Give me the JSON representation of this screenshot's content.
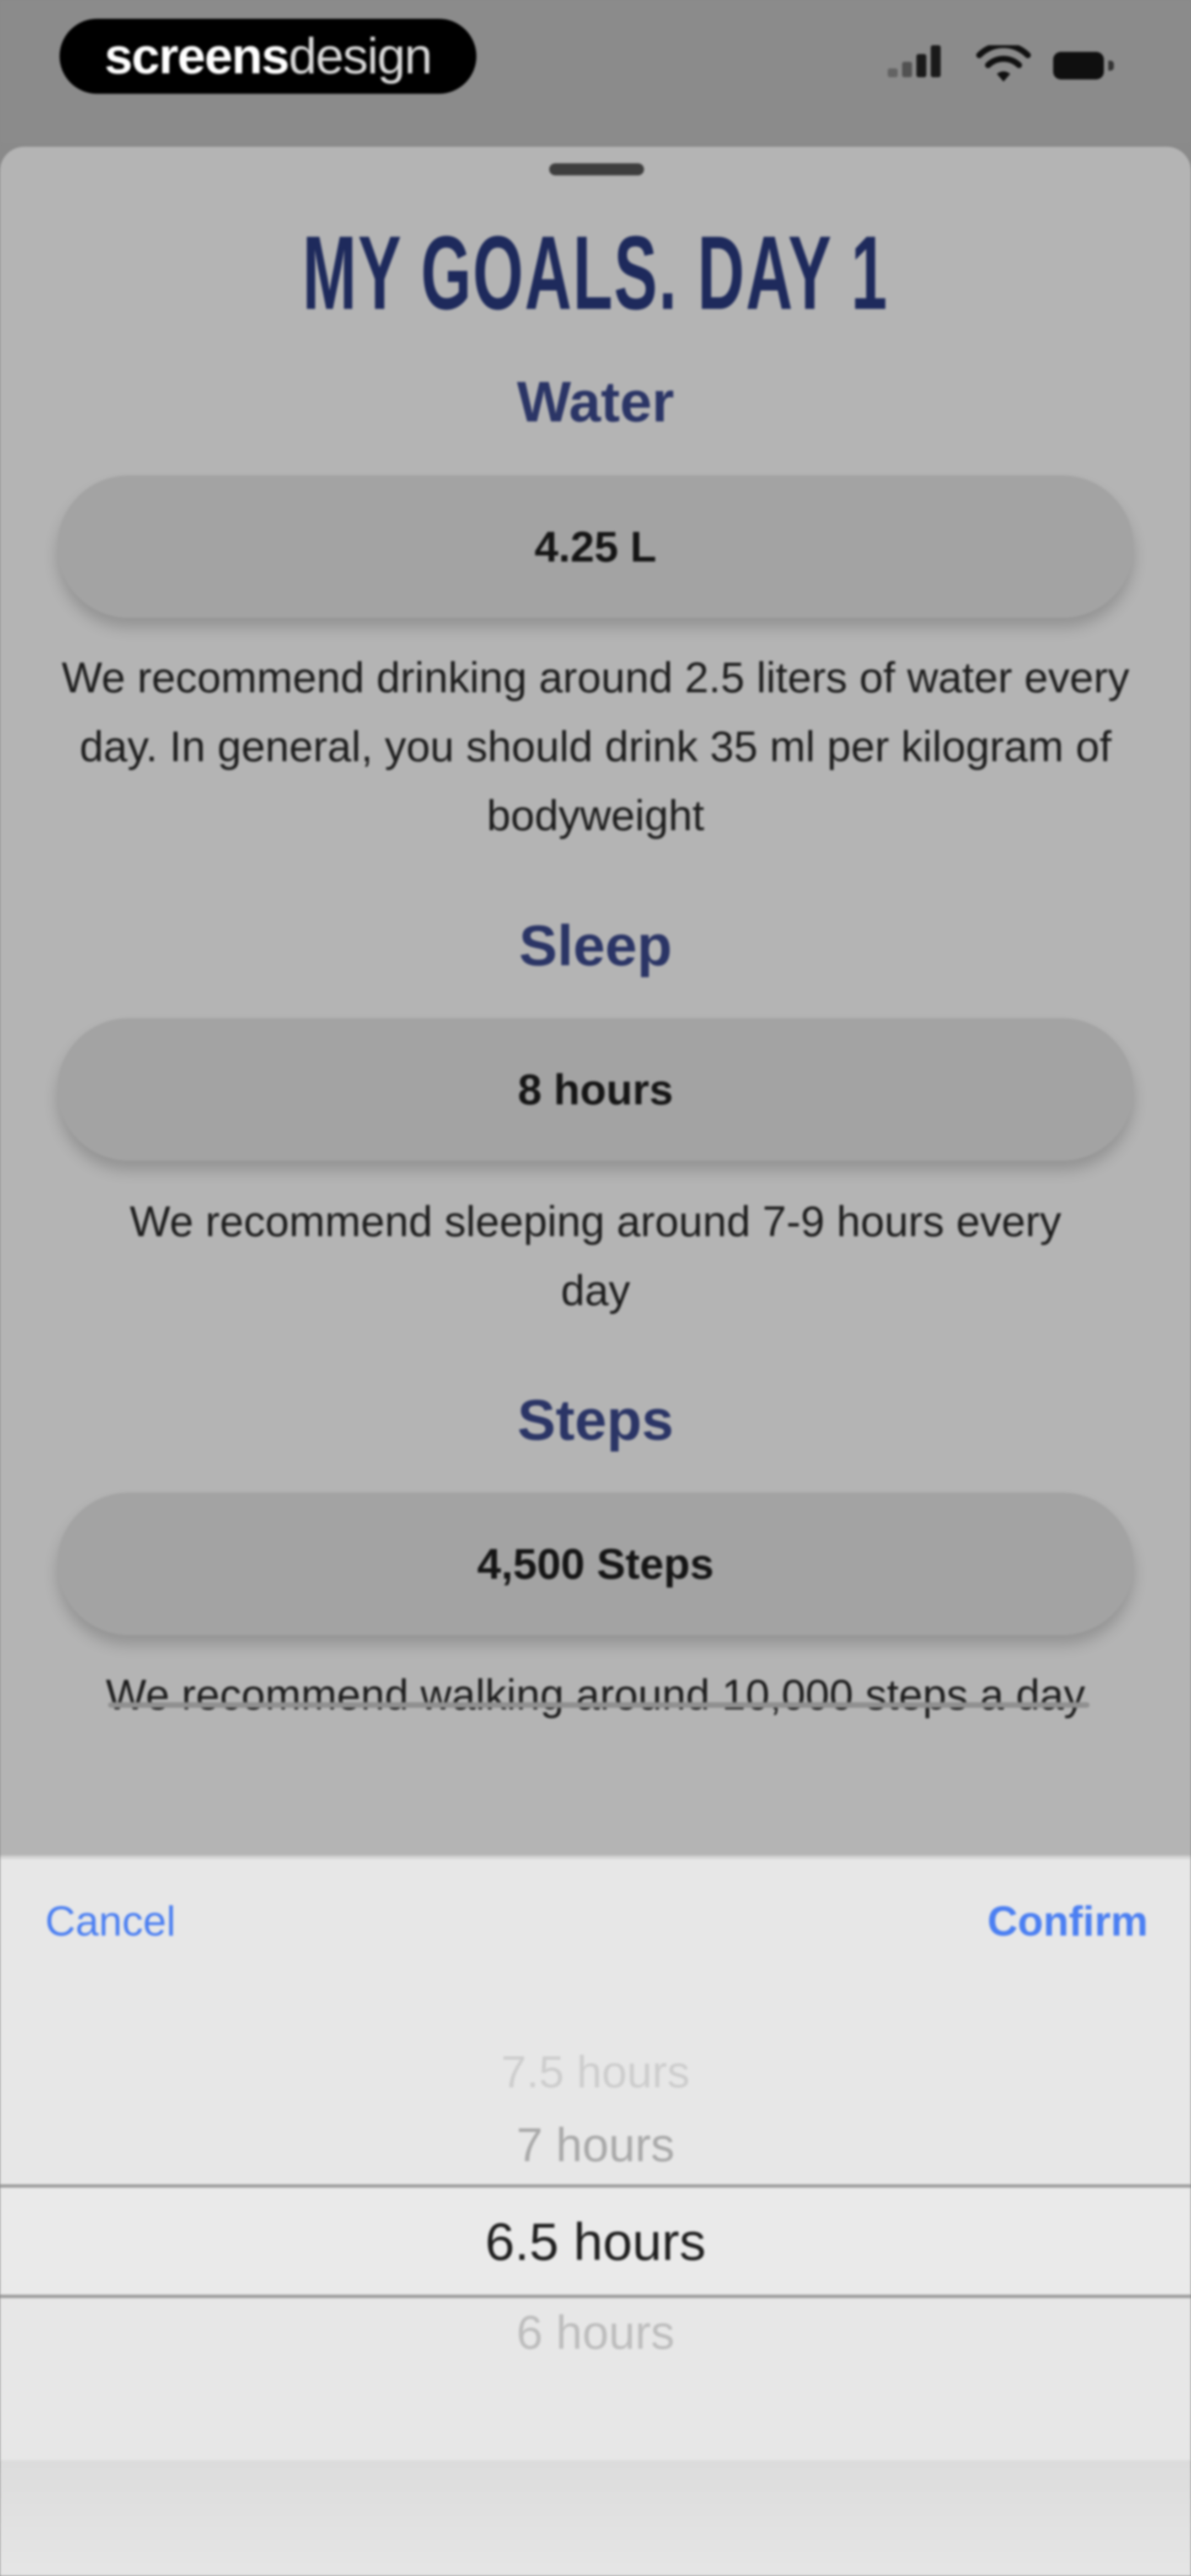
{
  "status_bar": {
    "brand": {
      "bold": "screens",
      "thin": "design"
    }
  },
  "title": "MY GOALS. DAY 1",
  "water": {
    "heading": "Water",
    "value": "4.25 L",
    "description": "We recommend drinking around 2.5 liters of water every day. In general, you should drink 35 ml per kilogram of bodyweight"
  },
  "sleep": {
    "heading": "Sleep",
    "value": "8 hours",
    "description": "We recommend sleeping around 7-9 hours every day"
  },
  "steps": {
    "heading": "Steps",
    "value": "4,500 Steps",
    "description": "We recommend walking around 10,000 steps a day"
  },
  "picker": {
    "cancel_label": "Cancel",
    "confirm_label": "Confirm",
    "options": [
      "7.5 hours",
      "7 hours",
      "6.5 hours",
      "6 hours"
    ],
    "selected": "6.5 hours"
  },
  "colors": {
    "accent": "#1e2a5c",
    "picker_button": "#4b7ff2",
    "sheet_background": "#b4b4b4"
  }
}
